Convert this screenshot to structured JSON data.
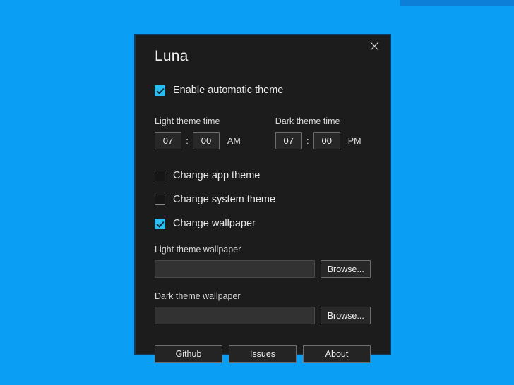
{
  "desktop": {
    "background_color": "#0a9ff5",
    "taskbar_strip_color": "#0d7fd6"
  },
  "dialog": {
    "title": "Luna",
    "close_icon": "close-icon",
    "accent_color": "#2bbdf0",
    "background_color": "#1c1c1c",
    "border_color": "#123a5e"
  },
  "enable_automatic": {
    "label": "Enable automatic theme",
    "checked": true
  },
  "light_theme_time": {
    "caption": "Light theme time",
    "hour": "07",
    "separator": ":",
    "minute": "00",
    "meridiem": "AM"
  },
  "dark_theme_time": {
    "caption": "Dark theme time",
    "hour": "07",
    "separator": ":",
    "minute": "00",
    "meridiem": "PM"
  },
  "options": [
    {
      "label": "Change app theme",
      "checked": false
    },
    {
      "label": "Change system theme",
      "checked": false
    },
    {
      "label": "Change wallpaper",
      "checked": true
    }
  ],
  "light_wallpaper": {
    "caption": "Light theme wallpaper",
    "value": "",
    "placeholder": "",
    "browse_label": "Browse..."
  },
  "dark_wallpaper": {
    "caption": "Dark theme wallpaper",
    "value": "",
    "placeholder": "",
    "browse_label": "Browse..."
  },
  "footer": {
    "github_label": "Github",
    "issues_label": "Issues",
    "about_label": "About"
  }
}
